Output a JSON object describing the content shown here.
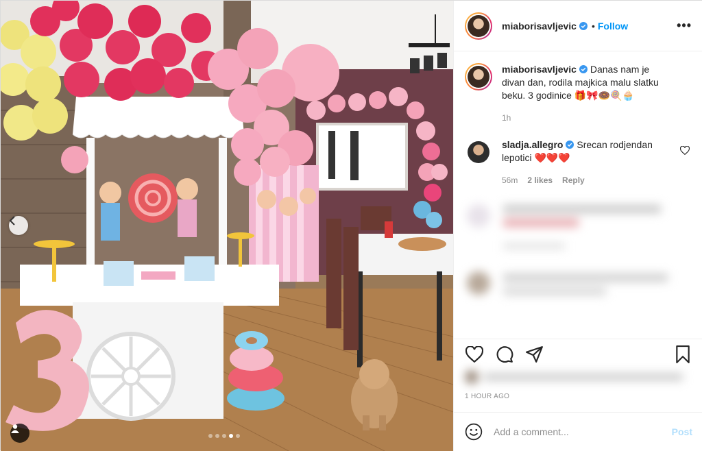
{
  "post": {
    "author": {
      "username": "miaborisavljevic",
      "verified": true,
      "follow_label": "Follow",
      "separator": "•"
    },
    "caption": {
      "username": "miaborisavljevic",
      "text": "Danas nam je divan dan, rodila majkica malu slatku beku. 3 godinice 🎁🎀🍩🍭🧁",
      "time": "1h"
    },
    "comments": [
      {
        "username": "sladja.allegro",
        "verified": true,
        "text": "Srecan rodjendan lepotici ❤️❤️❤️",
        "time": "56m",
        "likes": "2 likes",
        "reply_label": "Reply"
      }
    ],
    "timestamp": "1 HOUR AGO",
    "add_comment": {
      "placeholder": "Add a comment...",
      "post_label": "Post"
    },
    "carousel": {
      "total": 5,
      "active_index": 3
    },
    "icons": {
      "more": "more-options-icon",
      "like": "heart-icon",
      "comment": "comment-icon",
      "share": "paper-plane-icon",
      "save": "bookmark-icon",
      "emoji": "smiley-icon",
      "prev": "chevron-left-icon",
      "tags": "user-tag-icon"
    },
    "colors": {
      "link_blue": "#0095f6",
      "post_disabled": "#b2dffc",
      "heart_red": "#ed4956",
      "muted": "#8e8e8e"
    }
  }
}
